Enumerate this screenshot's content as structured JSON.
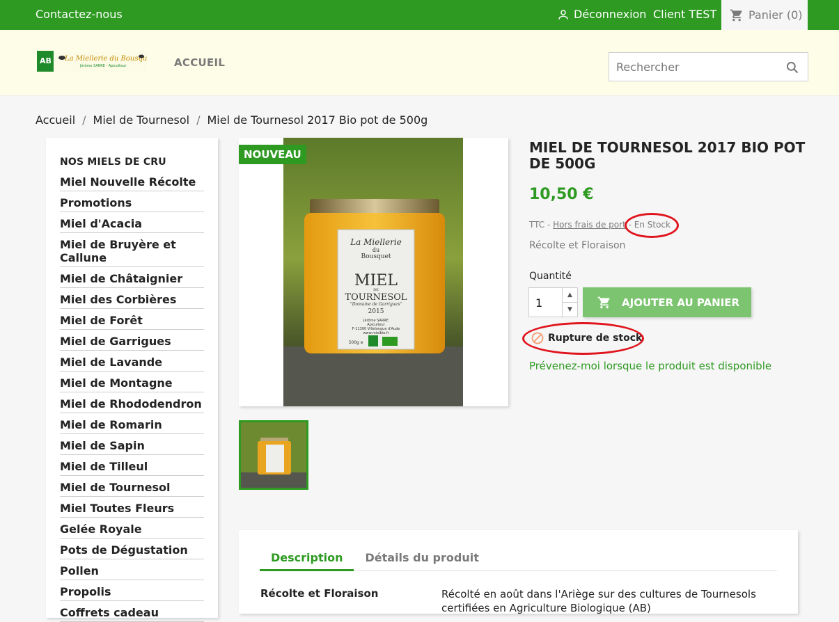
{
  "topbar": {
    "contact": "Contactez-nous",
    "logout": "Déconnexion",
    "client": "Client TEST",
    "cart": "Panier (0)"
  },
  "header": {
    "nav_home": "ACCUEIL",
    "search_placeholder": "Rechercher",
    "logo_text": "La Miellerie du Bousquet",
    "logo_ab": "AB"
  },
  "breadcrumb": [
    "Accueil",
    "Miel de Tournesol",
    "Miel de Tournesol 2017 Bio pot de 500g"
  ],
  "sidebar": {
    "title": "NOS MIELS DE CRU",
    "items": [
      "Miel Nouvelle Récolte",
      "Promotions",
      "Miel d'Acacia",
      "Miel de Bruyère et Callune",
      "Miel de Châtaignier",
      "Miel des Corbières",
      "Miel de Forêt",
      "Miel de Garrigues",
      "Miel de Lavande",
      "Miel de Montagne",
      "Miel de Rhododendron",
      "Miel de Romarin",
      "Miel de Sapin",
      "Miel de Tilleul",
      "Miel de Tournesol",
      "Miel Toutes Fleurs",
      "Gelée Royale",
      "Pots de Dégustation",
      "Pollen",
      "Propolis",
      "Coffrets cadeau"
    ]
  },
  "product": {
    "badge": "NOUVEAU",
    "title": "Miel de Tournesol 2017 Bio pot de 500g",
    "price": "10,50 €",
    "tax_prefix": "TTC - ",
    "shipping_link": "Hors frais de port",
    "stock_inline": " - En Stock",
    "short_desc": "Récolte et Floraison",
    "qty_label": "Quantité",
    "qty_value": "1",
    "add_to_cart": "AJOUTER AU PANIER",
    "out_of_stock": "Rupture de stock",
    "notify": "Prévenez-moi lorsque le produit est disponible",
    "label_lines": [
      "La Miellerie",
      "du",
      "Bousquet",
      "MIEL",
      "DE",
      "TOURNESOL",
      "\"Domaine de Garrigues\"",
      "2015",
      "Jérôme SARRE",
      "Apiculteur",
      "F-11300 Villelongue d'Aude",
      "www.mielbio.fr",
      "500g e"
    ]
  },
  "tabs": {
    "items": [
      "Description",
      "Détails du produit"
    ],
    "feature_name": "Récolte et Floraison",
    "feature_value": "Récolté en août dans l'Ariège sur des cultures de Tournesols certifiées en Agriculture Biologique (AB)"
  },
  "colors": {
    "brand_green": "#2e9a22",
    "button_green": "#7cc46f",
    "highlight_red": "#e0141d"
  }
}
